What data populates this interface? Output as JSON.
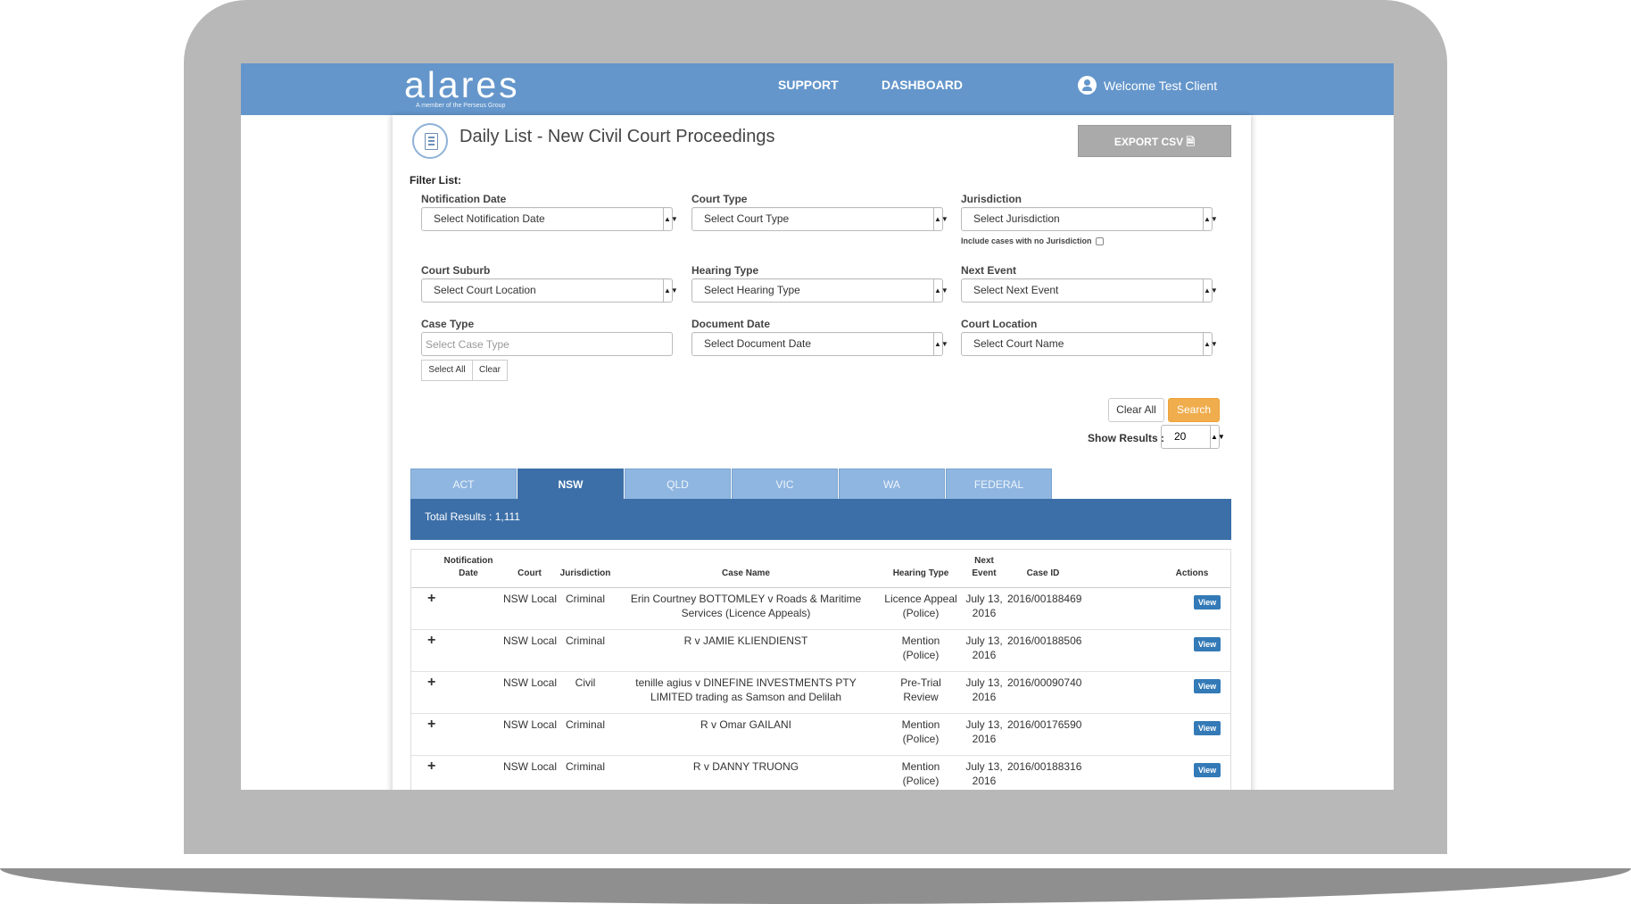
{
  "header": {
    "logo": "alares",
    "logo_tagline": "A member of the Perseus Group",
    "support": "SUPPORT",
    "dashboard": "DASHBOARD",
    "welcome": "Welcome Test Client"
  },
  "page": {
    "title": "Daily List - New Civil Court Proceedings",
    "export_label": "EXPORT CSV"
  },
  "filters": {
    "heading": "Filter List:",
    "notification_date": {
      "label": "Notification Date",
      "value": "Select Notification Date"
    },
    "court_type": {
      "label": "Court Type",
      "value": "Select Court Type"
    },
    "jurisdiction": {
      "label": "Jurisdiction",
      "value": "Select Jurisdiction",
      "include_label": "Include cases with no Jurisdiction"
    },
    "court_suburb": {
      "label": "Court Suburb",
      "value": "Select Court Location"
    },
    "hearing_type": {
      "label": "Hearing Type",
      "value": "Select Hearing Type"
    },
    "next_event": {
      "label": "Next Event",
      "value": "Select Next Event"
    },
    "case_type": {
      "label": "Case Type",
      "placeholder": "Select Case Type",
      "select_all": "Select All",
      "clear": "Clear"
    },
    "document_date": {
      "label": "Document Date",
      "value": "Select Document Date"
    },
    "court_location": {
      "label": "Court Location",
      "value": "Select Court Name"
    },
    "clear_all": "Clear All",
    "search": "Search",
    "show_results_label": "Show Results :",
    "show_results_value": "20"
  },
  "tabs": [
    "ACT",
    "NSW",
    "QLD",
    "VIC",
    "WA",
    "FEDERAL"
  ],
  "active_tab": "NSW",
  "results": {
    "total": "Total Results : 1,111"
  },
  "table": {
    "headers": {
      "notification_date": "Notification Date",
      "court": "Court",
      "jurisdiction": "Jurisdiction",
      "case_name": "Case Name",
      "hearing_type": "Hearing Type",
      "next_event": "Next Event",
      "case_id": "Case ID",
      "actions": "Actions"
    },
    "rows": [
      {
        "court": "NSW Local",
        "jurisdiction": "Criminal",
        "case_name": "Erin Courtney BOTTOMLEY v Roads & Maritime Services (Licence Appeals)",
        "hearing_type": "Licence Appeal (Police)",
        "next_event": "July 13, 2016",
        "case_id": "2016/00188469",
        "action": "View"
      },
      {
        "court": "NSW Local",
        "jurisdiction": "Criminal",
        "case_name": "R v JAMIE KLIENDIENST",
        "hearing_type": "Mention (Police)",
        "next_event": "July 13, 2016",
        "case_id": "2016/00188506",
        "action": "View"
      },
      {
        "court": "NSW Local",
        "jurisdiction": "Civil",
        "case_name": "tenille agius v DINEFINE INVESTMENTS PTY LIMITED trading as Samson and Delilah",
        "hearing_type": "Pre-Trial Review",
        "next_event": "July 13, 2016",
        "case_id": "2016/00090740",
        "action": "View"
      },
      {
        "court": "NSW Local",
        "jurisdiction": "Criminal",
        "case_name": "R v Omar GAILANI",
        "hearing_type": "Mention (Police)",
        "next_event": "July 13, 2016",
        "case_id": "2016/00176590",
        "action": "View"
      },
      {
        "court": "NSW Local",
        "jurisdiction": "Criminal",
        "case_name": "R v DANNY TRUONG",
        "hearing_type": "Mention (Police)",
        "next_event": "July 13, 2016",
        "case_id": "2016/00188316",
        "action": "View"
      }
    ]
  }
}
